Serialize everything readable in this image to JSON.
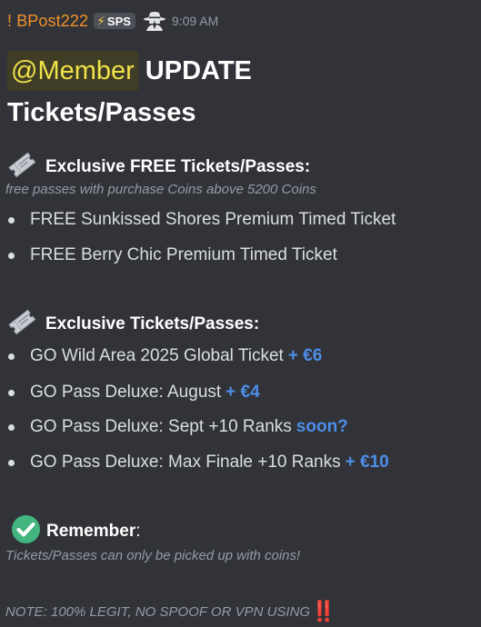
{
  "header": {
    "author": "! BPost222",
    "tag_icon": "lightning-bolt-icon",
    "tag_label": "SPS",
    "badge_icon": "spy-icon",
    "time": "9:09 AM"
  },
  "title": {
    "mention": "@Member",
    "word": "UPDATE",
    "line2": "Tickets/Passes"
  },
  "section_free": {
    "icon": "ticket-icon",
    "heading": "Exclusive FREE Tickets/Passes:",
    "note": "free passes with purchase Coins above 5200 Coins",
    "items": [
      {
        "text": "FREE Sunkissed Shores Premium Timed Ticket"
      },
      {
        "text": "FREE Berry Chic Premium Timed Ticket"
      }
    ]
  },
  "section_paid": {
    "icon": "ticket-icon",
    "heading": "Exclusive Tickets/Passes:",
    "items": [
      {
        "text": "GO Wild Area 2025 Global Ticket",
        "price": "+ €6"
      },
      {
        "text": "GO Pass Deluxe: August",
        "price": "+ €4"
      },
      {
        "text": "GO Pass Deluxe: Sept +10 Ranks",
        "price": "soon?"
      },
      {
        "text": "GO Pass Deluxe: Max Finale +10 Ranks",
        "price": "+ €10"
      }
    ]
  },
  "remember": {
    "icon": "check-mark-icon",
    "heading": "Remember",
    "colon": ":",
    "note": "Tickets/Passes can only be picked up with coins!"
  },
  "footer": {
    "note": "NOTE: 100% LEGIT, NO SPOOF OR VPN USING",
    "emoji": "‼️"
  },
  "colors": {
    "background": "#313338",
    "author": "#f0932b",
    "mention_text": "#f0e24a",
    "mention_bg": "#3f3d25",
    "price": "#4e8ee8",
    "muted": "#949ba4",
    "check": "#43b581"
  }
}
